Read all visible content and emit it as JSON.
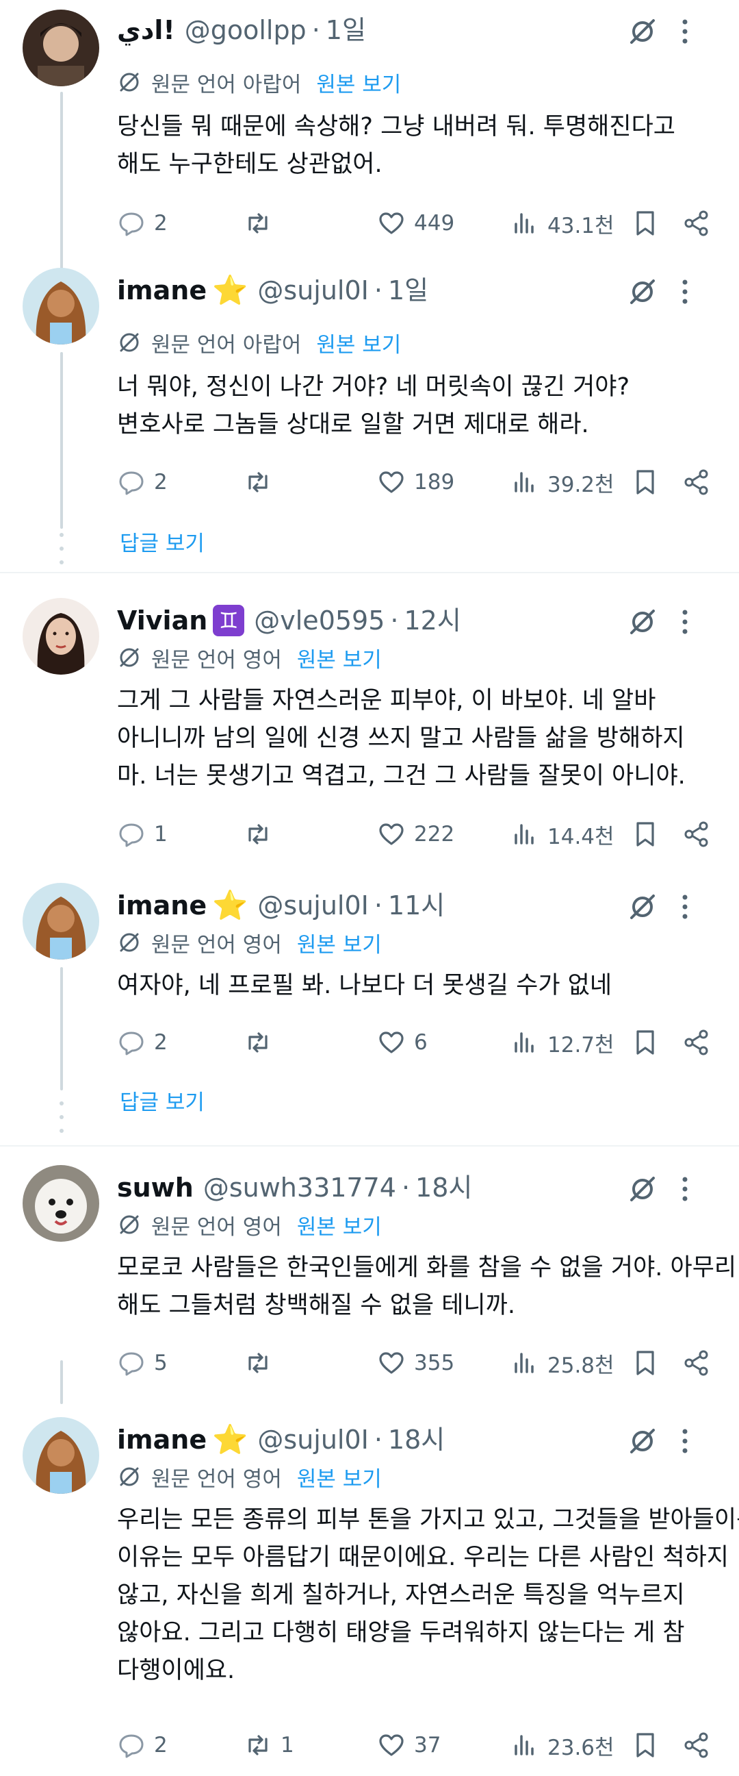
{
  "ui": {
    "translate_label": "원문 언어",
    "show_original": "원본 보기",
    "show_replies": "답글 보기"
  },
  "tweets": [
    {
      "name": "ادي!",
      "badge": "",
      "handle": "@goollpp",
      "time": "1일",
      "source_lang": "아랍어",
      "lines": [
        "당신들 뭐 때문에 속상해? 그냥 내버려 둬. 투명해진다고",
        "해도 누구한테도 상관없어."
      ],
      "replies": "2",
      "retweets": "",
      "likes": "449",
      "views": "43.1천"
    },
    {
      "name": "imane",
      "badge": "⭐",
      "handle": "@sujul0I",
      "time": "1일",
      "source_lang": "아랍어",
      "lines": [
        "너 뭐야, 정신이 나간 거야? 네 머릿속이 끊긴 거야?",
        "변호사로 그놈들 상대로 일할 거면 제대로 해라."
      ],
      "replies": "2",
      "retweets": "",
      "likes": "189",
      "views": "39.2천"
    },
    {
      "name": "Vivian",
      "badge": "♊",
      "handle": "@vle0595",
      "time": "12시",
      "source_lang": "영어",
      "lines": [
        "그게 그 사람들 자연스러운 피부야, 이 바보야. 네 알바",
        "아니니까 남의 일에 신경 쓰지 말고 사람들 삶을 방해하지",
        "마. 너는 못생기고 역겹고, 그건 그 사람들 잘못이 아니야."
      ],
      "replies": "1",
      "retweets": "",
      "likes": "222",
      "views": "14.4천"
    },
    {
      "name": "imane",
      "badge": "⭐",
      "handle": "@sujul0I",
      "time": "11시",
      "source_lang": "영어",
      "lines": [
        "여자야, 네 프로필 봐. 나보다 더 못생길 수가 없네"
      ],
      "replies": "2",
      "retweets": "",
      "likes": "6",
      "views": "12.7천"
    },
    {
      "name": "suwh",
      "badge": "",
      "handle": "@suwh331774",
      "time": "18시",
      "source_lang": "영어",
      "lines": [
        "모로코 사람들은 한국인들에게 화를 참을 수 없을 거야. 아무리",
        "해도 그들처럼 창백해질 수 없을 테니까."
      ],
      "replies": "5",
      "retweets": "",
      "likes": "355",
      "views": "25.8천"
    },
    {
      "name": "imane",
      "badge": "⭐",
      "handle": "@sujul0I",
      "time": "18시",
      "source_lang": "영어",
      "lines": [
        "우리는 모든 종류의 피부 톤을 가지고 있고, 그것들을 받아들이는",
        "이유는 모두 아름답기 때문이에요. 우리는 다른 사람인 척하지",
        "않고, 자신을 희게 칠하거나, 자연스러운 특징을 억누르지",
        "않아요. 그리고 다행히 태양을 두려워하지 않는다는 게 참",
        "다행이에요."
      ],
      "replies": "2",
      "retweets": "1",
      "likes": "37",
      "views": "23.6천"
    }
  ],
  "colors": {
    "text": "#0f1419",
    "secondary": "#536471",
    "link": "#1d9bf0",
    "divider": "#eff3f4",
    "thread": "#cfd9de"
  }
}
